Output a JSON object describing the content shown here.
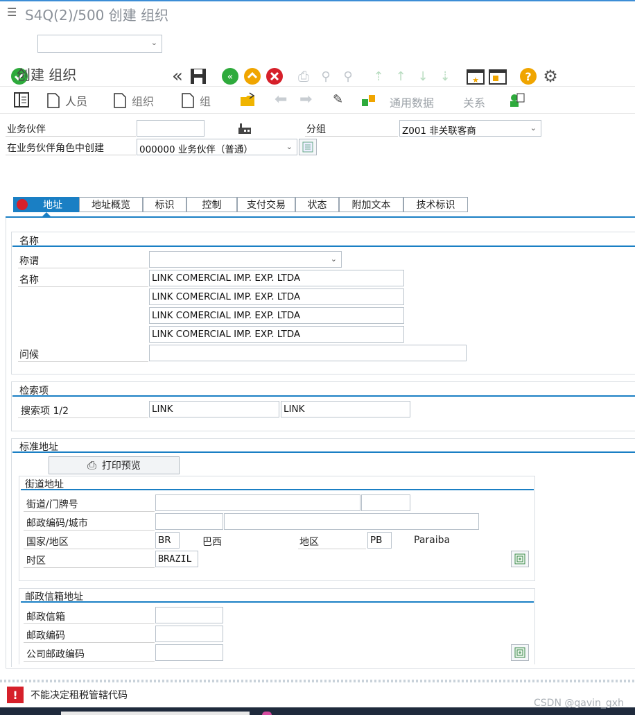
{
  "window": {
    "title": "S4Q(2)/500 创建 组织"
  },
  "toolbar": {
    "command_value": ""
  },
  "page": {
    "title": "创建 组织"
  },
  "app_toolbar": {
    "person": "人员",
    "org": "组织",
    "group": "组",
    "general_data": "通用数据",
    "relations": "关系"
  },
  "header": {
    "bp_label": "业务伙伴",
    "bp_value": "",
    "grouping_label": "分组",
    "grouping_value": "Z001 非关联客商",
    "role_label": "在业务伙伴角色中创建",
    "role_value": "000000 业务伙伴（普通）"
  },
  "tabs": [
    "地址",
    "地址概览",
    "标识",
    "控制",
    "支付交易",
    "状态",
    "附加文本",
    "技术标识"
  ],
  "name_section": {
    "title": "名称",
    "salutation_label": "称谓",
    "salutation_value": "",
    "name_label": "名称",
    "names": [
      "LINK COMERCIAL IMP. EXP. LTDA",
      "LINK COMERCIAL IMP. EXP. LTDA",
      "LINK COMERCIAL IMP. EXP. LTDA",
      "LINK COMERCIAL IMP. EXP. LTDA"
    ],
    "greeting_label": "问候",
    "greeting_value": ""
  },
  "search_section": {
    "title": "检索项",
    "search_label": "搜索项 1/2",
    "term1": "LINK",
    "term2": "LINK"
  },
  "address_section": {
    "title": "标准地址",
    "print_preview": "打印预览",
    "street_group_title": "街道地址",
    "street_label": "街道/门牌号",
    "postal_city_label": "邮政编码/城市",
    "country_label": "国家/地区",
    "country_code": "BR",
    "country_name": "巴西",
    "region_label": "地区",
    "region_code": "PB",
    "region_name": "Paraiba",
    "timezone_label": "时区",
    "timezone_value": "BRAZIL"
  },
  "pobox_section": {
    "title": "邮政信箱地址",
    "pobox_label": "邮政信箱",
    "postal_code_label": "邮政编码",
    "company_postal_label": "公司邮政编码"
  },
  "status_bar": {
    "message": "不能决定租税管辖代码"
  },
  "watermark": "CSDN @gavin_gxh",
  "colors": {
    "accent": "#1a7fc4",
    "ok_green": "#2eaa3c",
    "error_red": "#d6202a",
    "help_orange": "#f0a500"
  }
}
